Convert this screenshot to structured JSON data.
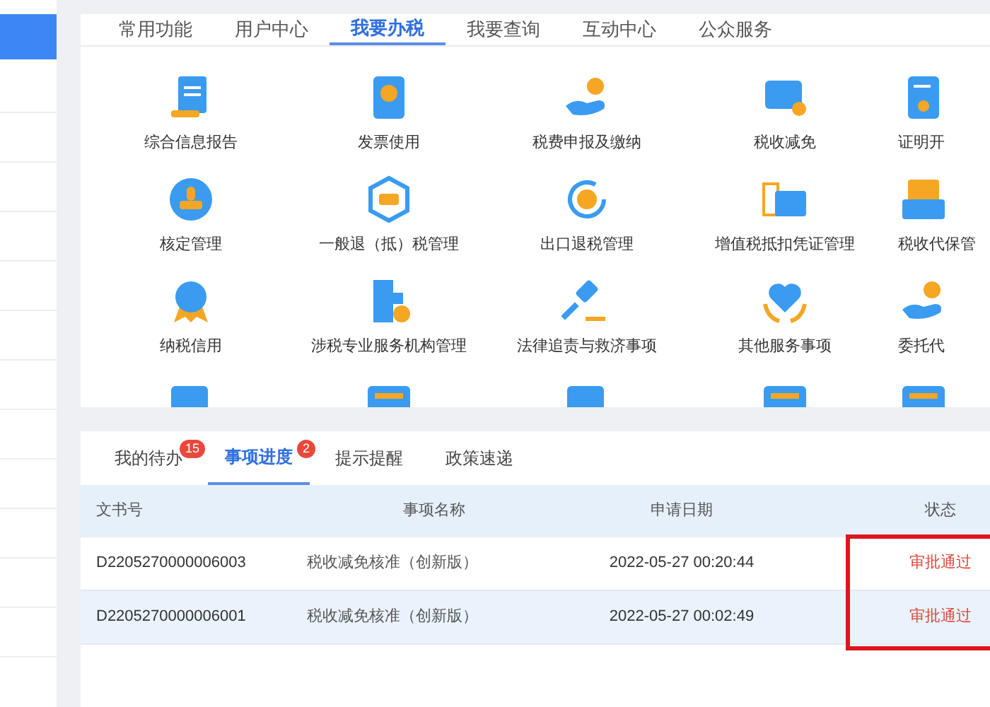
{
  "sidebar": {
    "items": [
      {
        "selected": true
      },
      {
        "selected": false
      },
      {
        "selected": false
      },
      {
        "selected": false
      },
      {
        "selected": false
      },
      {
        "selected": false
      },
      {
        "selected": false
      },
      {
        "selected": false
      },
      {
        "selected": false
      },
      {
        "selected": false
      },
      {
        "selected": false
      },
      {
        "selected": false
      },
      {
        "selected": false
      }
    ]
  },
  "service_tabs": [
    {
      "label": "常用功能",
      "selected": false
    },
    {
      "label": "用户中心",
      "selected": false
    },
    {
      "label": "我要办税",
      "selected": true
    },
    {
      "label": "我要查询",
      "selected": false
    },
    {
      "label": "互动中心",
      "selected": false
    },
    {
      "label": "公众服务",
      "selected": false
    }
  ],
  "services": [
    {
      "label": "综合信息报告",
      "kind": "scroll"
    },
    {
      "label": "发票使用",
      "kind": "invoice"
    },
    {
      "label": "税费申报及缴纳",
      "kind": "hand"
    },
    {
      "label": "税收减免",
      "kind": "card"
    },
    {
      "label": "证明开",
      "kind": "doc"
    },
    {
      "label": "核定管理",
      "kind": "stamp"
    },
    {
      "label": "一般退（抵）税管理",
      "kind": "hexagon"
    },
    {
      "label": "出口退税管理",
      "kind": "cycle"
    },
    {
      "label": "增值税抵扣凭证管理",
      "kind": "ticket"
    },
    {
      "label": "税收代保管",
      "kind": "tray"
    },
    {
      "label": "纳税信用",
      "kind": "medal"
    },
    {
      "label": "涉税专业服务机构管理",
      "kind": "building"
    },
    {
      "label": "法律追责与救济事项",
      "kind": "gavel"
    },
    {
      "label": "其他服务事项",
      "kind": "heart"
    },
    {
      "label": "委托代",
      "kind": "hand"
    },
    {
      "kind": "card"
    },
    {
      "kind": "screen"
    },
    {
      "kind": "card"
    },
    {
      "kind": "screen"
    },
    {
      "kind": "screen"
    }
  ],
  "task_tabs": [
    {
      "label": "我的待办",
      "badge": "15",
      "selected": false
    },
    {
      "label": "事项进度",
      "badge": "2",
      "selected": true
    },
    {
      "label": "提示提醒",
      "selected": false
    },
    {
      "label": "政策速递",
      "selected": false
    }
  ],
  "table": {
    "columns": [
      "文书号",
      "事项名称",
      "申请日期",
      "状态"
    ],
    "rows": [
      {
        "cells": [
          "D2205270000006003",
          "税收减免核准（创新版）",
          "2022-05-27 00:20:44",
          "审批通过"
        ],
        "selected": false
      },
      {
        "cells": [
          "D2205270000006001",
          "税收减免核准（创新版）",
          "2022-05-27 00:02:49",
          "审批通过"
        ],
        "selected": true
      }
    ],
    "status_column_highlighted": true
  }
}
